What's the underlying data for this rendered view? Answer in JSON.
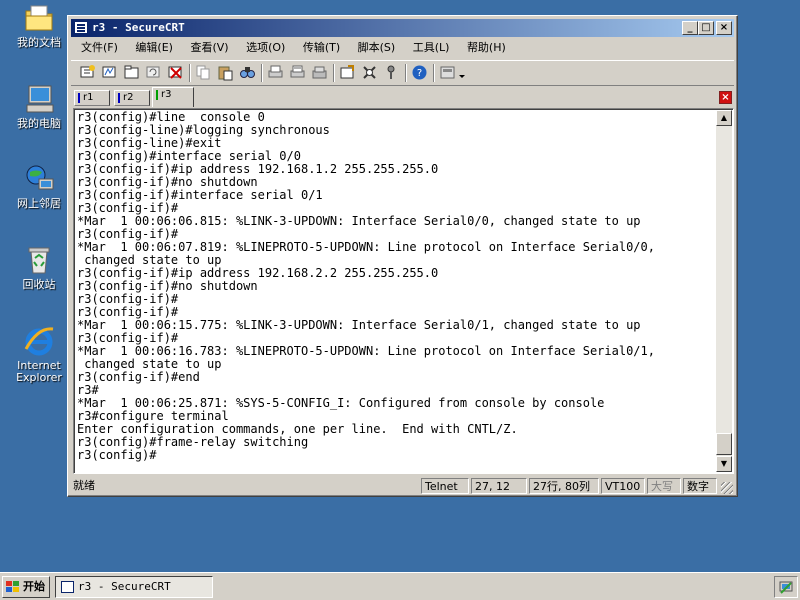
{
  "desktop": {
    "icons": [
      {
        "label": "我的文档",
        "icon": "my-documents-folder-icon"
      },
      {
        "label": "我的电脑",
        "icon": "my-computer-icon"
      },
      {
        "label": "网上邻居",
        "icon": "network-places-icon"
      },
      {
        "label": "回收站",
        "icon": "recycle-bin-icon"
      },
      {
        "label": "Internet Explorer",
        "icon": "internet-explorer-icon"
      }
    ]
  },
  "window": {
    "title": "r3 - SecureCRT",
    "buttons": {
      "minimize": "_",
      "maximize": "□",
      "close": "×"
    },
    "menu": [
      "文件(F)",
      "编辑(E)",
      "查看(V)",
      "选项(O)",
      "传输(T)",
      "脚本(S)",
      "工具(L)",
      "帮助(H)"
    ],
    "toolbar_icons": [
      "connect-icon",
      "quick-connect-icon",
      "connect-tab-icon",
      "reconnect-icon",
      "disconnect-icon",
      "copy-icon",
      "paste-icon",
      "find-icon",
      "print-icon",
      "print-selection-icon",
      "print-setup-icon",
      "session-options-icon",
      "global-options-icon",
      "keymap-icon",
      "help-icon",
      "script-icon",
      "more-icon"
    ],
    "tabs": [
      {
        "label": "r1",
        "active": false
      },
      {
        "label": "r2",
        "active": false
      },
      {
        "label": "r3",
        "active": true
      }
    ]
  },
  "terminal": {
    "lines": [
      "r3(config)#line  console 0",
      "r3(config-line)#logging synchronous",
      "r3(config-line)#exit",
      "r3(config)#interface serial 0/0",
      "r3(config-if)#ip address 192.168.1.2 255.255.255.0",
      "r3(config-if)#no shutdown",
      "r3(config-if)#interface serial 0/1",
      "r3(config-if)#",
      "*Mar  1 00:06:06.815: %LINK-3-UPDOWN: Interface Serial0/0, changed state to up",
      "r3(config-if)#",
      "*Mar  1 00:06:07.819: %LINEPROTO-5-UPDOWN: Line protocol on Interface Serial0/0,",
      " changed state to up",
      "r3(config-if)#ip address 192.168.2.2 255.255.255.0",
      "r3(config-if)#no shutdown",
      "r3(config-if)#",
      "r3(config-if)#",
      "*Mar  1 00:06:15.775: %LINK-3-UPDOWN: Interface Serial0/1, changed state to up",
      "r3(config-if)#",
      "*Mar  1 00:06:16.783: %LINEPROTO-5-UPDOWN: Line protocol on Interface Serial0/1,",
      " changed state to up",
      "r3(config-if)#end",
      "r3#",
      "*Mar  1 00:06:25.871: %SYS-5-CONFIG_I: Configured from console by console",
      "r3#configure terminal",
      "Enter configuration commands, one per line.  End with CNTL/Z.",
      "r3(config)#frame-relay switching",
      "r3(config)#"
    ]
  },
  "status": {
    "ready": "就绪",
    "protocol": "Telnet",
    "cursor": "27,  12",
    "size": "27行, 80列",
    "emulation": "VT100",
    "caps": "大写",
    "num": "数字"
  },
  "taskbar": {
    "start": "开始",
    "task": "r3 - SecureCRT"
  }
}
